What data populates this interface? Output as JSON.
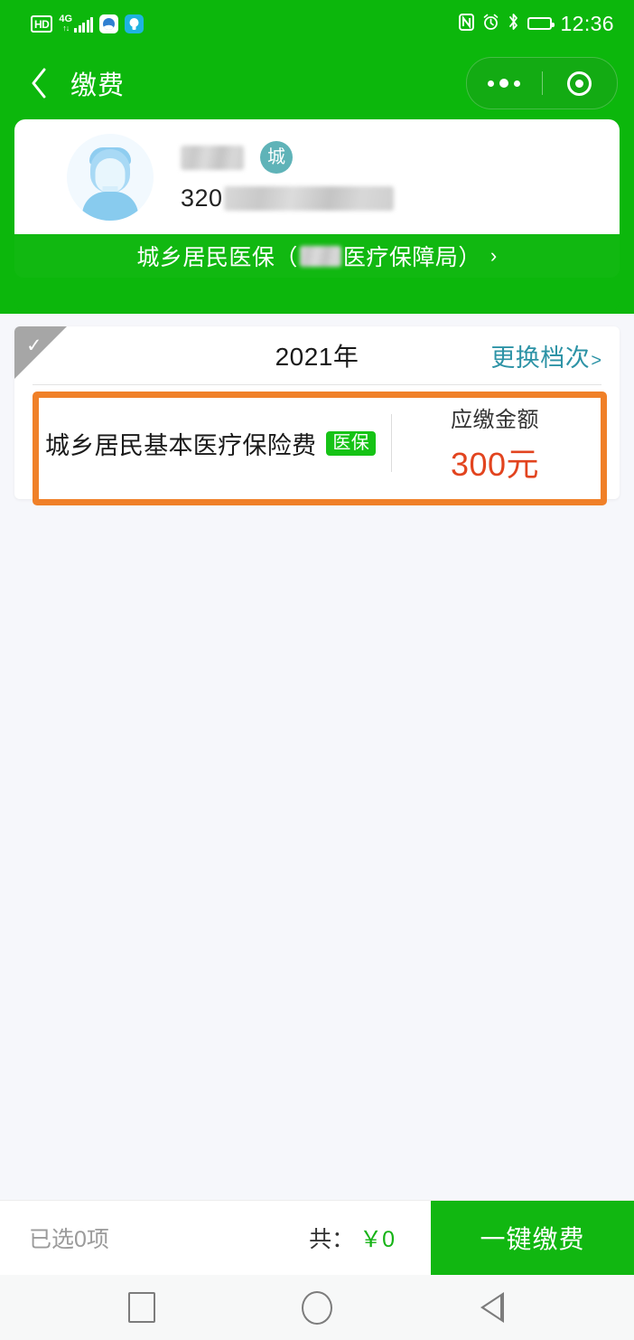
{
  "status_bar": {
    "hd_label": "HD",
    "network_type": "4G",
    "network_sub": "↑↓",
    "icons": [
      "hd-badge",
      "signal-bars",
      "app-icon",
      "flashlight-icon",
      "nfc-icon",
      "alarm-icon",
      "bluetooth-icon",
      "battery-icon"
    ],
    "nfc_glyph": "N",
    "alarm_glyph": "⏰",
    "bluetooth_glyph": "✻",
    "bulb_glyph": "💡",
    "time": "12:36"
  },
  "nav_header": {
    "title": "缴费",
    "back_icon": "back-chevron-icon",
    "capsule": {
      "menu_icon": "more-dots-icon",
      "close_icon": "target-circle-icon"
    }
  },
  "user_card": {
    "avatar_icon": "user-avatar",
    "name_masked": "",
    "city_badge": "城",
    "id_prefix": "320",
    "id_masked": "",
    "org_text_before": "城乡居民医保（",
    "org_text_after": "医疗保障局）",
    "org_chevron": "›"
  },
  "pay_card": {
    "ribbon_check": "✓",
    "year": "2021年",
    "change_tier_label": "更换档次",
    "change_tier_arrow": ">",
    "item": {
      "name": "城乡居民基本医疗保险费",
      "badge": "医保",
      "amount_label": "应缴金额",
      "amount_value": "300元"
    }
  },
  "bottom_bar": {
    "selected_count": "已选0项",
    "total_label": "共：",
    "total_amount": "￥0",
    "pay_button": "一键缴费"
  },
  "android_nav": {
    "recents": "recents-square-icon",
    "home": "home-circle-icon",
    "back": "back-triangle-icon"
  },
  "colors": {
    "brand_green": "#0cb70c",
    "button_green": "#11b711",
    "badge_green": "#16c316",
    "highlight_orange": "#f08028",
    "amount_red": "#e2441f",
    "link_teal": "#2d93a6",
    "city_badge_teal": "#5fb3b8",
    "page_bg": "#f6f7fb"
  }
}
